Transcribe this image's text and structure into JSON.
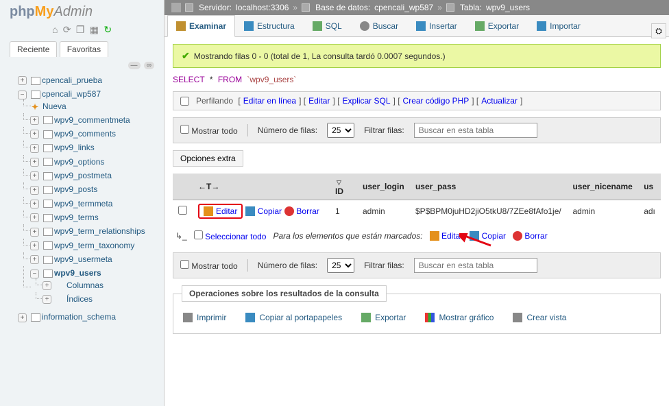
{
  "logo": {
    "p1": "php",
    "p2": "My",
    "p3": "Admin"
  },
  "history": {
    "recent": "Reciente",
    "favorites": "Favoritas"
  },
  "sidebar": {
    "items": [
      {
        "toggle": "+",
        "label": "cpencali_prueba"
      },
      {
        "toggle": "−",
        "label": "cpencali_wp587",
        "children": [
          {
            "new": true,
            "label": "Nueva"
          },
          {
            "toggle": "+",
            "label": "wpv9_commentmeta"
          },
          {
            "toggle": "+",
            "label": "wpv9_comments"
          },
          {
            "toggle": "+",
            "label": "wpv9_links"
          },
          {
            "toggle": "+",
            "label": "wpv9_options"
          },
          {
            "toggle": "+",
            "label": "wpv9_postmeta"
          },
          {
            "toggle": "+",
            "label": "wpv9_posts"
          },
          {
            "toggle": "+",
            "label": "wpv9_termmeta"
          },
          {
            "toggle": "+",
            "label": "wpv9_terms"
          },
          {
            "toggle": "+",
            "label": "wpv9_term_relationships"
          },
          {
            "toggle": "+",
            "label": "wpv9_term_taxonomy"
          },
          {
            "toggle": "+",
            "label": "wpv9_usermeta"
          },
          {
            "toggle": "−",
            "label": "wpv9_users",
            "sel": true,
            "children": [
              {
                "toggle": "+",
                "label": "Columnas",
                "col": true
              },
              {
                "toggle": "+",
                "label": "Índices",
                "idx": true
              }
            ]
          }
        ]
      },
      {
        "toggle": "+",
        "label": "information_schema"
      }
    ]
  },
  "breadcrumb": {
    "server_lbl": "Servidor:",
    "server": "localhost:3306",
    "db_lbl": "Base de datos:",
    "db": "cpencali_wp587",
    "table_lbl": "Tabla:",
    "table": "wpv9_users"
  },
  "tabs": [
    {
      "id": "browse",
      "label": "Examinar",
      "active": true
    },
    {
      "id": "structure",
      "label": "Estructura"
    },
    {
      "id": "sql",
      "label": "SQL"
    },
    {
      "id": "search",
      "label": "Buscar"
    },
    {
      "id": "insert",
      "label": "Insertar"
    },
    {
      "id": "export",
      "label": "Exportar"
    },
    {
      "id": "import",
      "label": "Importar"
    }
  ],
  "success": "Mostrando filas 0 - 0 (total de 1, La consulta tardó 0.0007 segundos.)",
  "sql": {
    "select": "SELECT",
    "star": "*",
    "from": "FROM",
    "table": "`wpv9_users`"
  },
  "linkbar": {
    "profiling": "Perfilando",
    "l1": "Editar en línea",
    "l2": "Editar",
    "l3": "Explicar SQL",
    "l4": "Crear código PHP",
    "l5": "Actualizar"
  },
  "ctrl": {
    "showall": "Mostrar todo",
    "numrows": "Número de filas:",
    "rows": "25",
    "filter": "Filtrar filas:",
    "placeholder": "Buscar en esta tabla"
  },
  "optextra": "Opciones extra",
  "table": {
    "headers": {
      "arrows": "←T→",
      "id": "ID",
      "login": "user_login",
      "pass": "user_pass",
      "nice": "user_nicename",
      "us": "us"
    },
    "row": {
      "edit": "Editar",
      "copy": "Copiar",
      "delete": "Borrar",
      "id": "1",
      "login": "admin",
      "pass": "$P$BPM0juHD2jiO5tkU8/7ZEe8fAfo1je/",
      "nice": "admin",
      "us": "adı"
    }
  },
  "selectall": {
    "label": "Seleccionar todo",
    "hint": "Para los elementos que están marcados:",
    "edit": "Editar",
    "copy": "Copiar",
    "delete": "Borrar"
  },
  "fieldset": {
    "legend": "Operaciones sobre los resultados de la consulta",
    "ops": {
      "print": "Imprimir",
      "clip": "Copiar al portapapeles",
      "export": "Exportar",
      "chart": "Mostrar gráfico",
      "view": "Crear vista"
    }
  }
}
